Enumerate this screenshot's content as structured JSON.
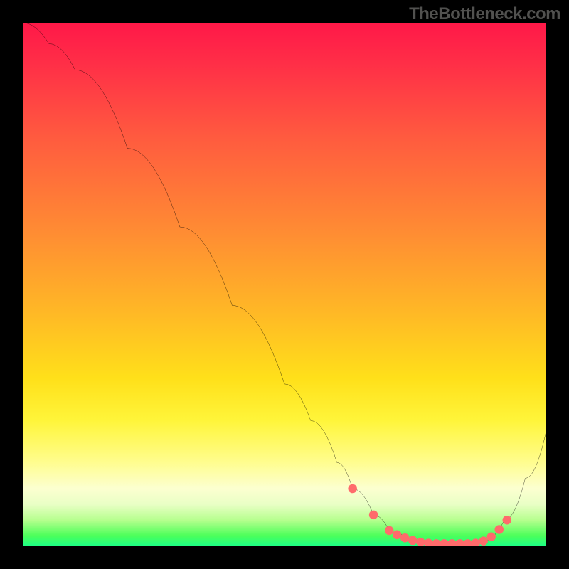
{
  "watermark": "TheBottleneck.com",
  "chart_data": {
    "type": "line",
    "title": "",
    "xlabel": "",
    "ylabel": "",
    "xlim": [
      0,
      100
    ],
    "ylim": [
      0,
      100
    ],
    "grid": false,
    "legend": false,
    "series": [
      {
        "name": "curve",
        "color": "#000000",
        "x": [
          0,
          5,
          10,
          20,
          30,
          40,
          50,
          55,
          60,
          63,
          67,
          70,
          74,
          78,
          82,
          86,
          88,
          92,
          96,
          100
        ],
        "y": [
          100,
          96,
          91,
          76,
          61,
          46,
          31,
          24,
          16,
          11,
          6,
          3,
          1,
          0.5,
          0.5,
          0.5,
          1,
          5,
          13,
          22
        ]
      }
    ],
    "markers": {
      "name": "dots",
      "color": "#ff6b6b",
      "x": [
        63,
        67,
        70,
        71.5,
        73,
        74.5,
        76,
        77.5,
        79,
        80.5,
        82,
        83.5,
        85,
        86.5,
        88,
        89.5,
        91,
        92.5
      ],
      "y": [
        11,
        6,
        3,
        2.2,
        1.6,
        1.1,
        0.8,
        0.6,
        0.5,
        0.5,
        0.5,
        0.5,
        0.5,
        0.6,
        1,
        1.8,
        3.2,
        5
      ]
    },
    "gradient_stops": [
      {
        "pos": 0.0,
        "color": "#ff1848"
      },
      {
        "pos": 0.4,
        "color": "#ff8c33"
      },
      {
        "pos": 0.68,
        "color": "#ffe01a"
      },
      {
        "pos": 0.89,
        "color": "#fcffd0"
      },
      {
        "pos": 1.0,
        "color": "#1bff86"
      }
    ]
  }
}
